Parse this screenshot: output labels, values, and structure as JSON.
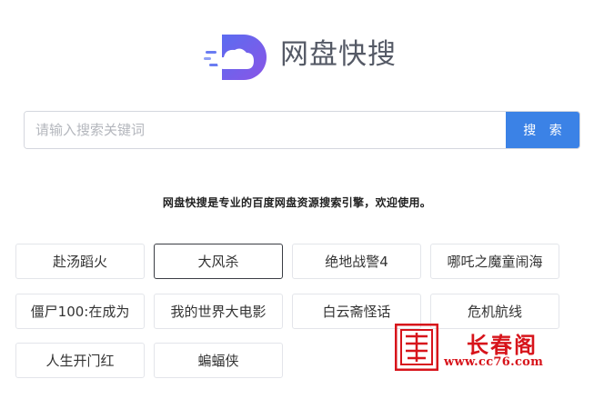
{
  "logo": {
    "text": "网盘快搜",
    "icon": "cloud-logo-icon"
  },
  "search": {
    "placeholder": "请输入搜索关键词",
    "value": "",
    "button_label": "搜 索"
  },
  "tagline": "网盘快搜是专业的百度网盘资源搜索引擎，欢迎使用。",
  "keywords": [
    "赴汤蹈火",
    "大风杀",
    "绝地战警4",
    "哪吒之魔童闹海",
    "僵尸100:在成为",
    "我的世界大电影",
    "白云斋怪话",
    "危机航线",
    "人生开门红",
    "蝙蝠侠"
  ],
  "watermark": {
    "title": "长春阁",
    "url": "www.cc76.com",
    "color": "#d7141b"
  },
  "colors": {
    "accent": "#3b82e6",
    "logo_text": "#555a66"
  }
}
